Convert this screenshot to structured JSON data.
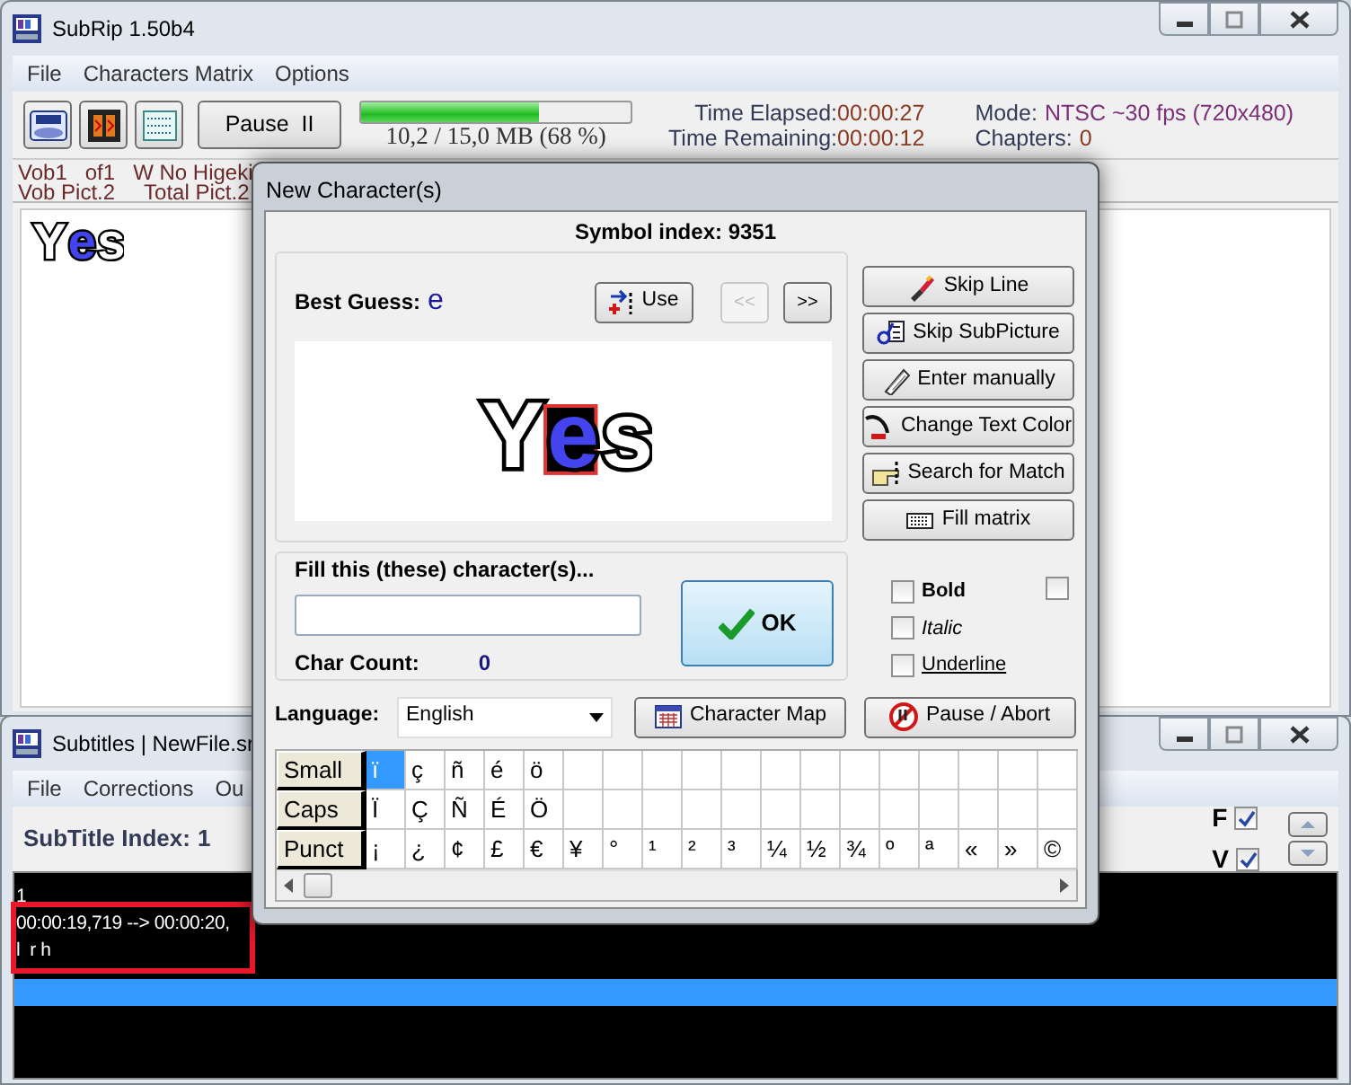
{
  "main_window": {
    "title": "SubRip 1.50b4",
    "menu": [
      "File",
      "Characters Matrix",
      "Options"
    ],
    "pause_button": "Pause  II",
    "progress": {
      "level": 0.66,
      "caption": "10,2 / 15,0 MB (68 %)"
    },
    "stats": [
      {
        "label": "Time Elapsed:",
        "value": "00:00:27"
      },
      {
        "label": "Time Remaining:",
        "value": "00:00:12"
      }
    ],
    "mode": {
      "label": "Mode:",
      "value": "NTSC ~30 fps (720x480)"
    },
    "chapters": {
      "label": "Chapters:",
      "value": "0"
    },
    "info_rows": [
      [
        "Vob1",
        "of1",
        "W No Higeki"
      ],
      [
        "Vob Pict.2",
        "Total Pict.2"
      ]
    ],
    "preview": [
      {
        "char": "Y",
        "current": false
      },
      {
        "char": "e",
        "current": true
      },
      {
        "char": "s",
        "current": false
      }
    ]
  },
  "dialog": {
    "title": "New Character(s)",
    "symbol_index": "Symbol index: 9351",
    "best_guess": {
      "label": "Best Guess:",
      "value": "e"
    },
    "use_button": "Use",
    "nav_buttons": [
      {
        "label": "<<",
        "disabled": true
      },
      {
        "label": ">>",
        "disabled": false
      }
    ],
    "glyph_preview": [
      {
        "char": "Y",
        "current": false
      },
      {
        "char": "e",
        "current": true
      },
      {
        "char": "s",
        "current": false
      }
    ],
    "side_buttons": [
      {
        "label": "Skip Line",
        "kind": "brush"
      },
      {
        "label": "Skip SubPicture",
        "kind": "pages"
      },
      {
        "label": "Enter manually",
        "kind": "pen"
      },
      {
        "label": "Change Text Color",
        "kind": "curve"
      },
      {
        "label": "Search for Match",
        "kind": "hand"
      },
      {
        "label": "Fill matrix",
        "kind": "grid"
      }
    ],
    "fill": {
      "legend": "Fill this (these) character(s)...",
      "count_label": "Char Count:",
      "count_value": "0"
    },
    "ok_button": "OK",
    "styles": [
      {
        "label": "Bold",
        "kind": "bold",
        "checked": false
      },
      {
        "label": "Italic",
        "kind": "italic",
        "checked": false
      },
      {
        "label": "Underline",
        "kind": "underline",
        "checked": false
      }
    ],
    "extra_checkbox": {
      "checked": false
    },
    "language": {
      "label": "Language:",
      "value": "English"
    },
    "char_map_button": "Character Map",
    "pause_button": "Pause / Abort",
    "char_rows": [
      {
        "label": "Small",
        "cells": [
          {
            "c": "ï",
            "selected": true
          },
          {
            "c": "ç",
            "selected": false
          },
          {
            "c": "ñ",
            "selected": false
          },
          {
            "c": "é",
            "selected": false
          },
          {
            "c": "ö",
            "selected": false
          }
        ]
      },
      {
        "label": "Caps",
        "cells": [
          {
            "c": "Ï",
            "selected": false
          },
          {
            "c": "Ç",
            "selected": false
          },
          {
            "c": "Ñ",
            "selected": false
          },
          {
            "c": "É",
            "selected": false
          },
          {
            "c": "Ö",
            "selected": false
          }
        ]
      },
      {
        "label": "Punct",
        "cells": [
          {
            "c": "¡",
            "selected": false
          },
          {
            "c": "¿",
            "selected": false
          },
          {
            "c": "¢",
            "selected": false
          },
          {
            "c": "£",
            "selected": false
          },
          {
            "c": "€",
            "selected": false
          },
          {
            "c": "¥",
            "selected": false
          },
          {
            "c": "°",
            "selected": false
          },
          {
            "c": "¹",
            "selected": false
          },
          {
            "c": "²",
            "selected": false
          },
          {
            "c": "³",
            "selected": false
          },
          {
            "c": "¼",
            "selected": false
          },
          {
            "c": "½",
            "selected": false
          },
          {
            "c": "¾",
            "selected": false
          },
          {
            "c": "º",
            "selected": false
          },
          {
            "c": "ª",
            "selected": false
          },
          {
            "c": "«",
            "selected": false
          },
          {
            "c": "»",
            "selected": false
          },
          {
            "c": "©",
            "selected": false
          }
        ]
      }
    ]
  },
  "subtitles_window": {
    "title": "Subtitles | NewFile.sr",
    "menu": [
      "File",
      "Corrections",
      "Ou"
    ],
    "index": {
      "label": "SubTitle Index:",
      "value": "1"
    },
    "flags": [
      {
        "label": "F",
        "checked": true
      },
      {
        "label": "V",
        "checked": true
      }
    ],
    "lines": [
      "1",
      "00:00:19,719 --> 00:00:20,",
      "l  r h"
    ],
    "selection_bar": true,
    "highlight_frame": true
  }
}
